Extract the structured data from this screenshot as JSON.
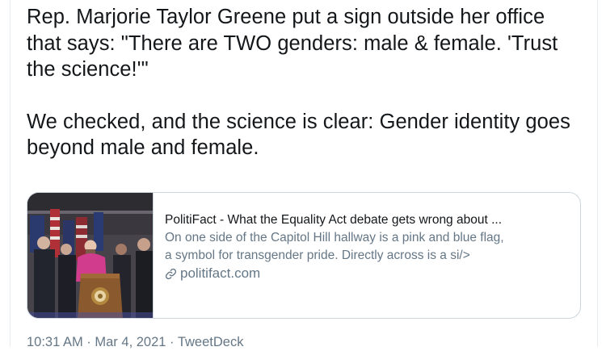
{
  "tweet": {
    "paragraph_1": "Rep. Marjorie Taylor Greene put a sign outside her office that says: \"There are TWO genders: male & female. 'Trust the science!'\"",
    "paragraph_2": "We checked, and the science is clear: Gender identity goes beyond male and female."
  },
  "link_card": {
    "title": "PolitiFact - What the Equality Act debate gets wrong about ...",
    "description_line_1": "On one side of the Capitol Hill hallway is a pink and blue flag,",
    "description_line_2": "a symbol for transgender pride. Directly across is a si/>",
    "domain": "politifact.com",
    "link_icon": "link-icon",
    "image_description_icon": "press-conference-photo"
  },
  "meta": {
    "time": "10:31 AM",
    "separator_1": " · ",
    "date": "Mar 4, 2021",
    "separator_2": " · ",
    "source": "TweetDeck"
  },
  "colors": {
    "text_primary": "#14171a",
    "text_secondary": "#657786",
    "border": "#ccd6dd"
  }
}
